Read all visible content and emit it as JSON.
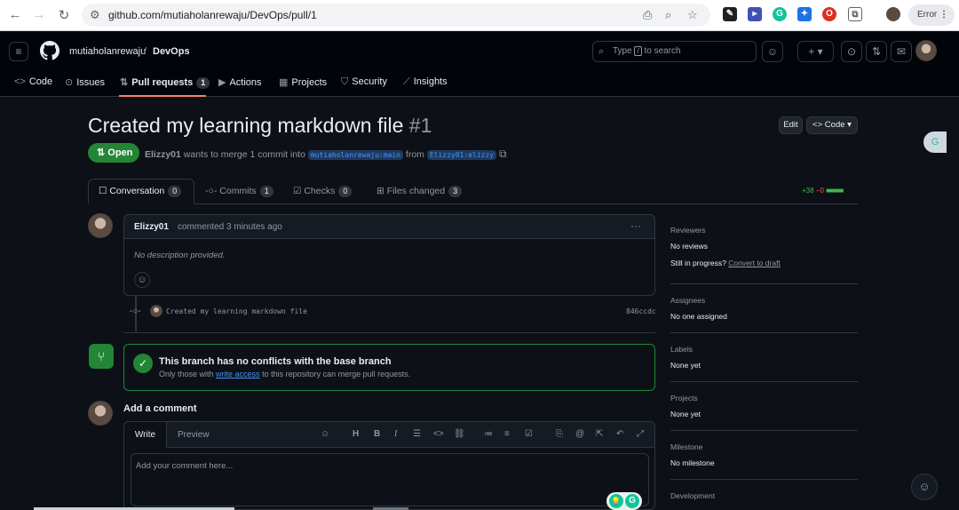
{
  "browser": {
    "url": "github.com/mutiaholanrewaju/DevOps/pull/1",
    "error_label": "Error"
  },
  "header": {
    "owner": "mutiaholanrewaju",
    "separator": "/",
    "repo": "DevOps",
    "search_prefix": "Type",
    "search_key": "/",
    "search_suffix": "to search",
    "plus": "+"
  },
  "repo_tabs": [
    {
      "label": "Code",
      "icon": "code-icon"
    },
    {
      "label": "Issues",
      "icon": "issue-icon"
    },
    {
      "label": "Pull requests",
      "icon": "pr-icon",
      "count": "1"
    },
    {
      "label": "Actions",
      "icon": "play-icon"
    },
    {
      "label": "Projects",
      "icon": "table-icon"
    },
    {
      "label": "Security",
      "icon": "shield-icon"
    },
    {
      "label": "Insights",
      "icon": "graph-icon"
    }
  ],
  "pr": {
    "title": "Created my learning markdown file",
    "number": "#1",
    "state": "Open",
    "author": "Elizzy01",
    "meta_mid": "wants to merge 1 commit into",
    "base_branch": "mutiaholanrewaju:main",
    "from": "from",
    "head_branch": "Elizzy01:elizzy",
    "edit_label": "Edit",
    "code_label": "Code"
  },
  "pr_tabs": [
    {
      "label": "Conversation",
      "count": "0"
    },
    {
      "label": "Commits",
      "count": "1"
    },
    {
      "label": "Checks",
      "count": "0"
    },
    {
      "label": "Files changed",
      "count": "3"
    }
  ],
  "diffstat": {
    "added": "+38",
    "removed": "−0"
  },
  "comment": {
    "author": "Elizzy01",
    "action": "commented 3 minutes ago",
    "body": "No description provided.",
    "more": "···"
  },
  "commit": {
    "message": "Created my learning markdown file",
    "sha": "846ccdc"
  },
  "merge": {
    "title": "This branch has no conflicts with the base branch",
    "sub_prefix": "Only those with",
    "sub_link": "write access",
    "sub_suffix": "to this repository can merge pull requests."
  },
  "add_comment": {
    "heading": "Add a comment",
    "write_tab": "Write",
    "preview_tab": "Preview",
    "placeholder": "Add your comment here..."
  },
  "sidebar": {
    "reviewers_h": "Reviewers",
    "reviewers_v": "No reviews",
    "progress_text": "Still in progress?",
    "progress_link": "Convert to draft",
    "assignees_h": "Assignees",
    "assignees_v": "No one assigned",
    "labels_h": "Labels",
    "labels_v": "None yet",
    "projects_h": "Projects",
    "projects_v": "None yet",
    "milestone_h": "Milestone",
    "milestone_v": "No milestone",
    "development_h": "Development"
  },
  "colors": {
    "open": "#238636",
    "accent": "#f78166",
    "link": "#4493f8"
  }
}
